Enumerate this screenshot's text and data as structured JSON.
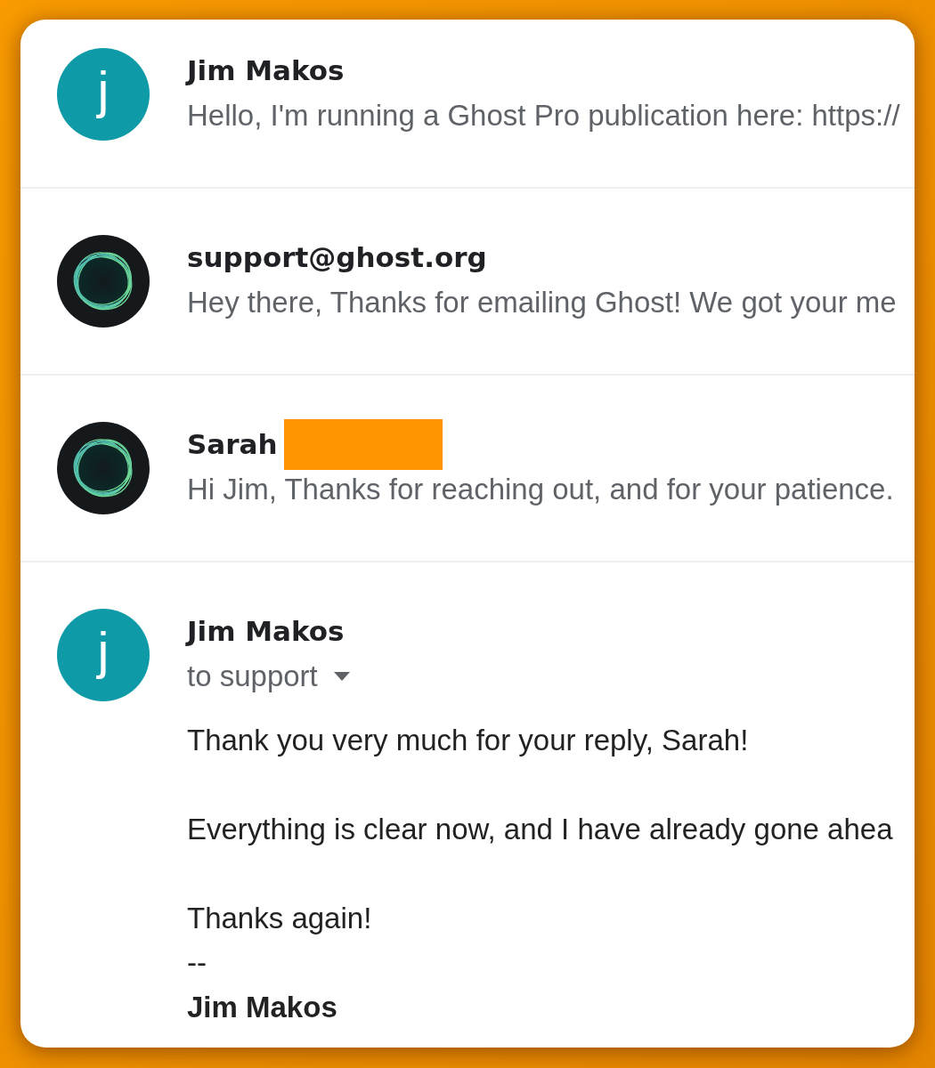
{
  "messages": [
    {
      "expanded": false,
      "avatar": {
        "kind": "letter",
        "letter": "j"
      },
      "sender": "Jim Makos",
      "name_redacted": false,
      "snippet": "Hello, I'm running a Ghost Pro publication here: https://"
    },
    {
      "expanded": false,
      "avatar": {
        "kind": "logo"
      },
      "sender": "support@ghost.org",
      "name_redacted": false,
      "snippet": "Hey there, Thanks for emailing Ghost! We got your me"
    },
    {
      "expanded": false,
      "avatar": {
        "kind": "logo"
      },
      "sender": "Sarah",
      "name_redacted": true,
      "snippet": "Hi Jim, Thanks for reaching out, and for your patience."
    },
    {
      "expanded": true,
      "avatar": {
        "kind": "letter",
        "letter": "j"
      },
      "sender": "Jim Makos",
      "name_redacted": false,
      "recipients": "to support",
      "body": {
        "paragraphs": [
          "Thank you very much for your reply, Sarah!",
          "Everything is clear now, and I have already gone ahea",
          "Thanks again!"
        ],
        "signature_separator": "--",
        "signature_name": "Jim Makos"
      }
    }
  ]
}
